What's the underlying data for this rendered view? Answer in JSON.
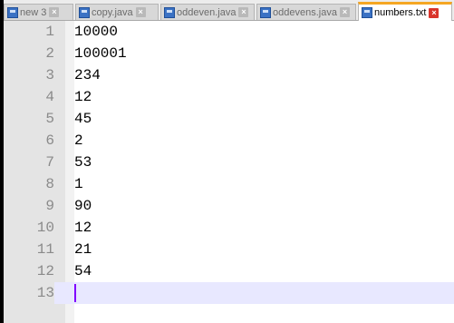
{
  "tabs": [
    {
      "label": "new 3",
      "active": false
    },
    {
      "label": "copy.java",
      "active": false
    },
    {
      "label": "oddeven.java",
      "active": false
    },
    {
      "label": "oddevens.java",
      "active": false
    },
    {
      "label": "numbers.txt",
      "active": true
    }
  ],
  "close_symbol": "×",
  "editor": {
    "lines": [
      {
        "num": "1",
        "text": "10000"
      },
      {
        "num": "2",
        "text": "100001"
      },
      {
        "num": "3",
        "text": "234"
      },
      {
        "num": "4",
        "text": "12"
      },
      {
        "num": "5",
        "text": "45"
      },
      {
        "num": "6",
        "text": "2"
      },
      {
        "num": "7",
        "text": "53"
      },
      {
        "num": "8",
        "text": "1"
      },
      {
        "num": "9",
        "text": "90"
      },
      {
        "num": "10",
        "text": "12"
      },
      {
        "num": "11",
        "text": "21"
      },
      {
        "num": "12",
        "text": "54"
      },
      {
        "num": "13",
        "text": ""
      }
    ],
    "current_line": 13
  },
  "colors": {
    "active_tab_accent": "#f5a623",
    "active_close": "#d9342b",
    "current_line_bg": "#e8e8ff",
    "caret": "#8000ff"
  }
}
